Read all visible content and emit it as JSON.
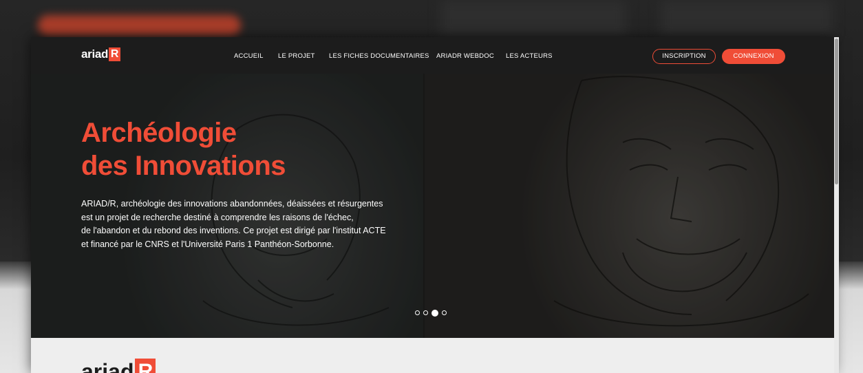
{
  "site": {
    "logo_word": "ariad",
    "logo_box": "R"
  },
  "nav": {
    "items": [
      {
        "label": "ACCUEIL"
      },
      {
        "label": "LE PROJET"
      },
      {
        "label": "LES FICHES DOCUMENTAIRES"
      },
      {
        "label": "ARIADR WEBDOC"
      },
      {
        "label": "LES ACTEURS"
      }
    ],
    "inscription_label": "INSCRIPTION",
    "connexion_label": "CONNEXION"
  },
  "hero": {
    "title_line1": "Archéologie",
    "title_line2": "des Innovations",
    "description_lines": [
      "ARIAD/R, archéologie des innovations abandonnées, déaissées et résurgentes",
      "est un projet de recherche destiné à comprendre les raisons de l'échec,",
      "de l'abandon et du rebond des inventions. Ce projet est dirigé par l'institut ACTE",
      "et financé par le CNRS et l'Université Paris 1 Panthéon-Sorbonne."
    ],
    "carousel": {
      "slide_count": 4,
      "active_slide": 3
    }
  },
  "colors": {
    "accent": "#f04d37",
    "nav_bg": "#1c1c1c",
    "page_bg": "#eeeeee"
  },
  "icons": {
    "logo": "ariadr-logo",
    "dots": "carousel-dot"
  }
}
